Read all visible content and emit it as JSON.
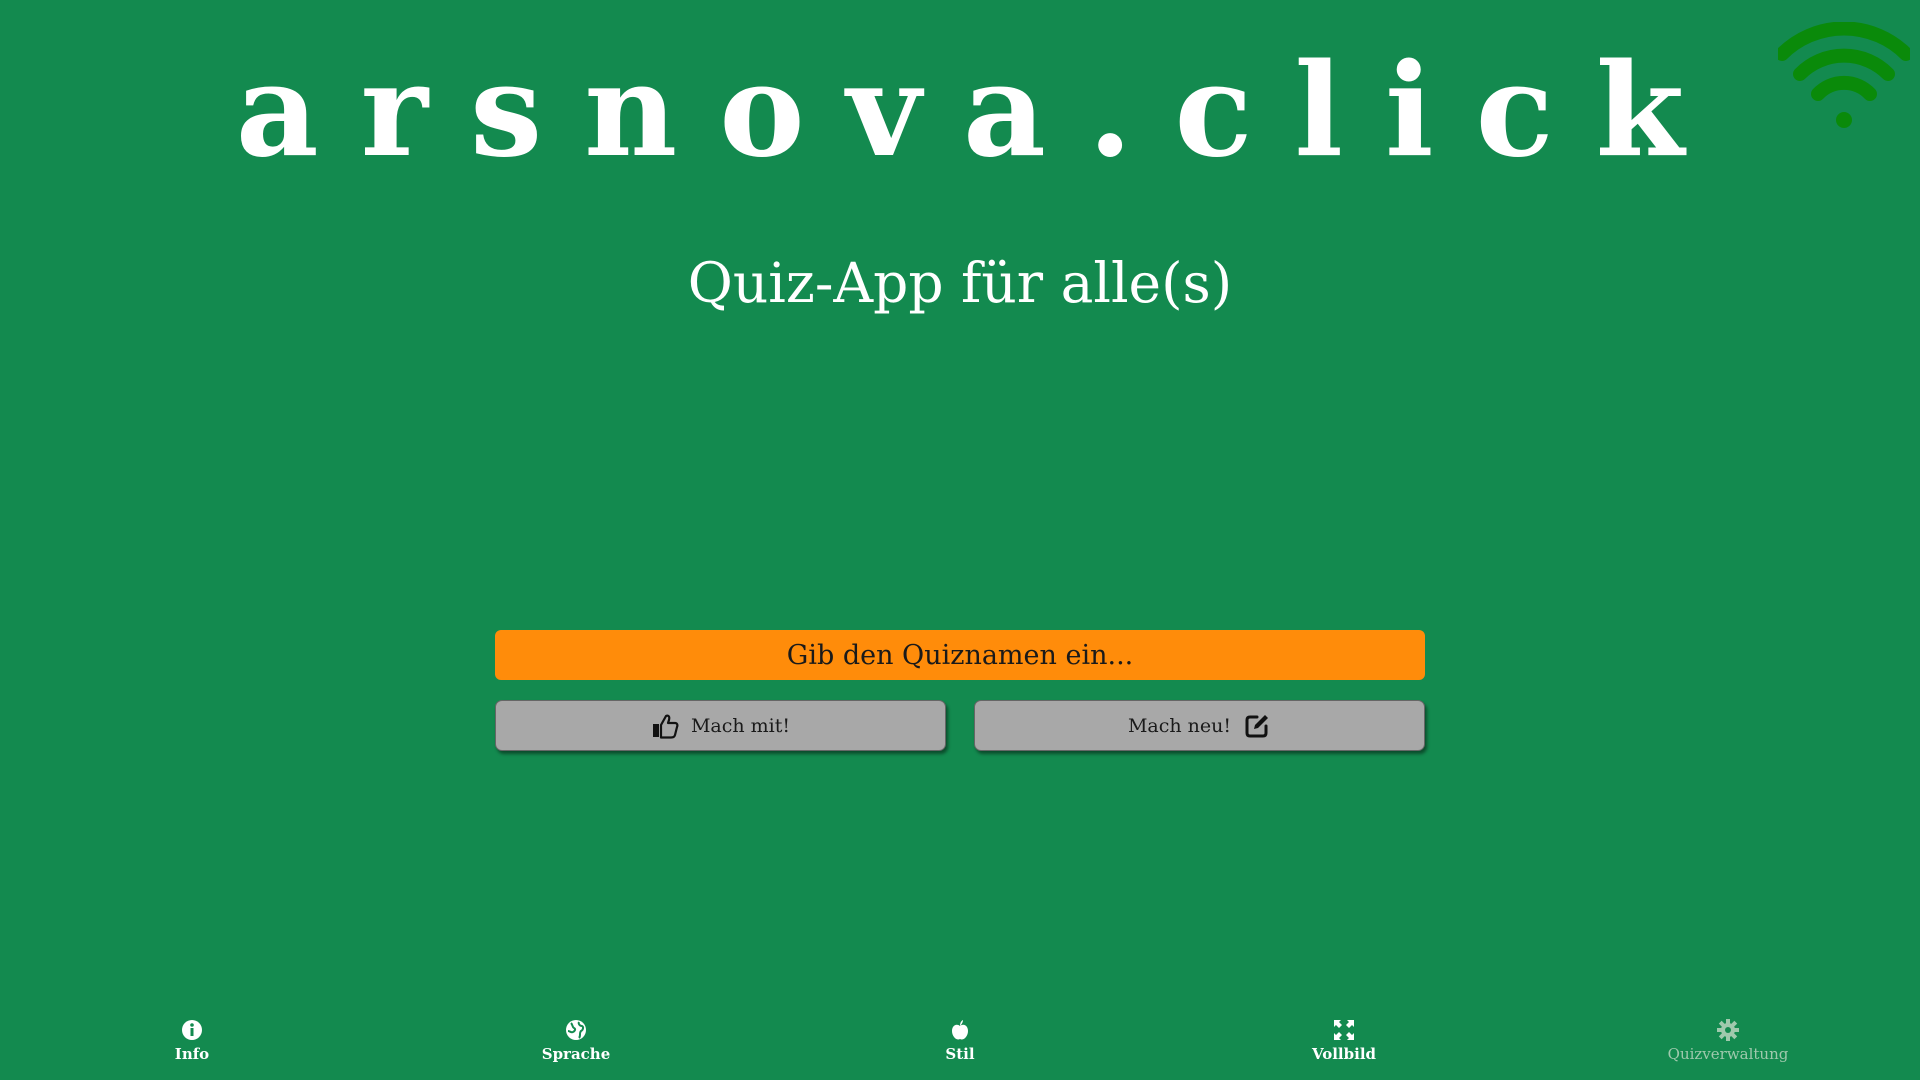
{
  "header": {
    "logo": "arsnova.click",
    "subtitle": "Quiz-App für alle(s)"
  },
  "status": {
    "connection_icon": "wifi-icon",
    "connection_color": "#0a8a0a"
  },
  "quiz_input": {
    "placeholder": "Gib den Quiznamen ein...",
    "value": "",
    "background": "#ff8c0a"
  },
  "actions": {
    "join_label": "Mach mit!",
    "join_icon": "thumbs-up-icon",
    "new_label": "Mach neu!",
    "new_icon": "edit-icon"
  },
  "footer": {
    "items": [
      {
        "label": "Info",
        "icon": "info-icon"
      },
      {
        "label": "Sprache",
        "icon": "globe-icon"
      },
      {
        "label": "Stil",
        "icon": "apple-icon"
      },
      {
        "label": "Vollbild",
        "icon": "fullscreen-icon"
      },
      {
        "label": "Quizverwaltung",
        "icon": "gear-icon",
        "disabled": true
      }
    ]
  },
  "colors": {
    "background": "#138a4f",
    "button": "#a8a8a8"
  }
}
